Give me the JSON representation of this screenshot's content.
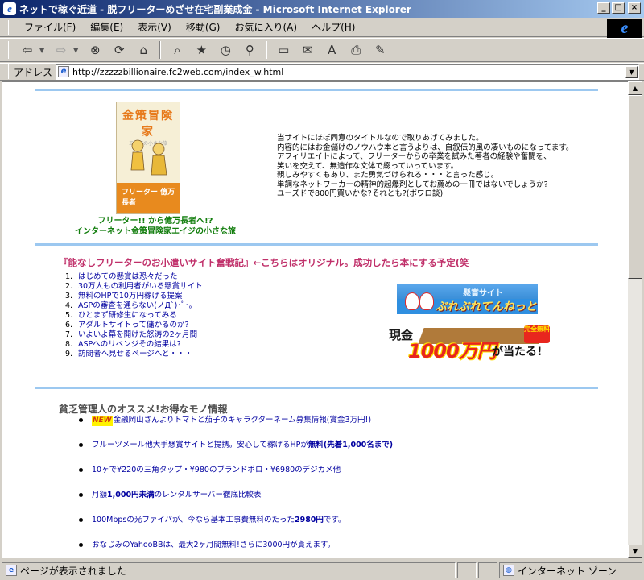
{
  "window": {
    "title": "ネットで稼ぐ近道 - 脱フリーターめざせ在宅副業成金 - Microsoft Internet Explorer",
    "buttons": [
      "_",
      "□",
      "×"
    ]
  },
  "menu": [
    "ファイル(F)",
    "編集(E)",
    "表示(V)",
    "移動(G)",
    "お気に入り(A)",
    "ヘルプ(H)"
  ],
  "toolbar": {
    "icons": [
      "back-icon",
      "forward-icon",
      "stop-icon",
      "refresh-icon",
      "home-icon",
      "search-icon",
      "favorites-icon",
      "history-icon",
      "channels-icon",
      "fullscreen-icon",
      "mail-icon",
      "font-icon",
      "print-icon",
      "edit-icon"
    ]
  },
  "address": {
    "label": "アドレス",
    "url": "http://zzzzzbillionaire.fc2web.com/index_w.html"
  },
  "page": {
    "book": {
      "title": "金策冒険家",
      "subtitle": "エイジの小さな旅",
      "band_text": "フリーター 億万長者",
      "caption_line1": "フリーター!! から億万長者へ!?",
      "caption_line2": "インターネット金策冒険家エイジの小さな旅"
    },
    "intro_lines": [
      "当サイトにほぼ同意のタイトルなので取りあげてみました。",
      "内容的にはお金儲けのノウハウ本と言うよりは、自叙伝的風の凄いものになってます。",
      "アフィリエイトによって、フリーターからの卒業を試みた著者の経験や奮闘を、",
      "笑いを交えて、無造作な文体で綴っていっています。",
      "親しみやすくもあり、また勇気づけられる・・・と言った感じ。",
      "単調なネットワーカーの精神的起爆剤としてお薦めの一冊ではないでしょうか?",
      "ユーズドで800円買いかな?それとも?(ボワロ談)"
    ],
    "section_title": "『能なしフリーターのお小遣いサイト奮戦記』←こちらはオリジナル。成功したら本にする予定(笑",
    "episodes": [
      {
        "num": "1.",
        "text": "はじめての懸賞は恐々だった"
      },
      {
        "num": "2.",
        "text": "30万人もの利用者がいる懸賞サイト"
      },
      {
        "num": "3.",
        "text": "無料のHPで10万円稼げる提案"
      },
      {
        "num": "4.",
        "text": "ASPの審査を通らない(ノД`)･ﾟ･｡"
      },
      {
        "num": "5.",
        "text": "ひとまず研修生になってみる"
      },
      {
        "num": "6.",
        "text": "アダルトサイトって儲かるのか?"
      },
      {
        "num": "7.",
        "text": "いよいよ幕を開けた怒涛の2ヶ月間"
      },
      {
        "num": "8.",
        "text": "ASPへのリベンジその結果は?"
      },
      {
        "num": "9.",
        "text": "訪問者へ見せるページへと・・・"
      }
    ],
    "banner1": {
      "label": "懸賞サイト",
      "name": "ぶれぶれてんねっと"
    },
    "banner2": {
      "cash": "現金",
      "amount": "1000万円",
      "suffix": "が当たる!",
      "badge": "完全無料"
    },
    "recommend_title": "貧乏管理人のオススメ!お得なモノ情報",
    "recommend": [
      {
        "new": "NEW",
        "text": "金融岡山さんよりトマトと茄子のキャラクターネーム募集情報(賞金3万円!)"
      },
      {
        "new": "",
        "text": "フルーツメール他大手懸賞サイトと提携。安心して稼げるHPが",
        "bold": "無料(先着1,000名まで)"
      },
      {
        "new": "",
        "text": "10ヶで¥220の三角タップ・¥980のブランドポロ・¥6980のデジカメ他"
      },
      {
        "new": "",
        "text": "月額",
        "bold": "1,000円未満",
        "text2": "のレンタルサーバー徹底比較表"
      },
      {
        "new": "",
        "text": "100Mbpsの光ファイバが、今なら基本工事費無料のたった",
        "bold": "2980円",
        "text2": "です。"
      },
      {
        "new": "",
        "text": "おなじみのYahooBBは、最大2ヶ月間無料!さらに3000円が貰えます。"
      }
    ]
  },
  "status": {
    "message": "ページが表示されました",
    "zone": "インターネット ゾーン"
  }
}
